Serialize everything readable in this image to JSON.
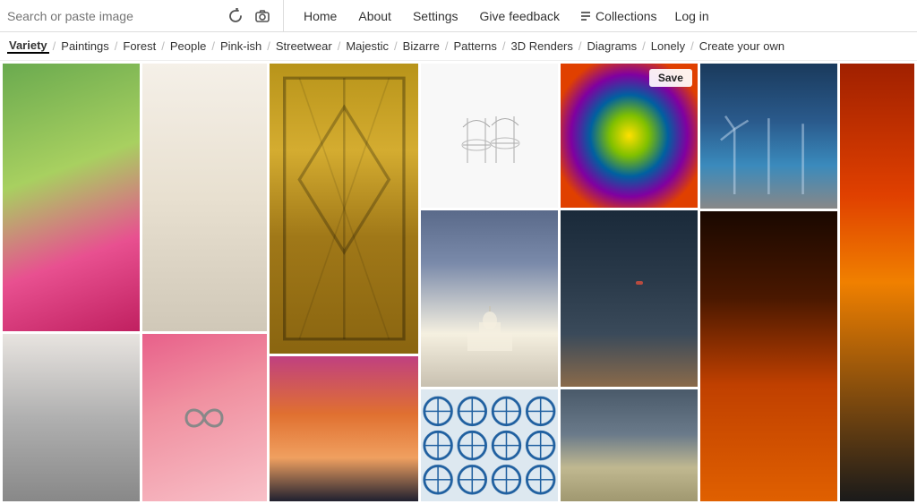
{
  "header": {
    "search_placeholder": "Search or paste image",
    "nav": {
      "home": "Home",
      "about": "About",
      "settings": "Settings",
      "give_feedback": "Give feedback",
      "collections": "Collections",
      "login": "Log in"
    }
  },
  "categories": [
    {
      "label": "Variety",
      "active": true
    },
    {
      "label": "Paintings",
      "active": false
    },
    {
      "label": "Forest",
      "active": false
    },
    {
      "label": "People",
      "active": false
    },
    {
      "label": "Pink-ish",
      "active": false
    },
    {
      "label": "Streetwear",
      "active": false
    },
    {
      "label": "Majestic",
      "active": false
    },
    {
      "label": "Bizarre",
      "active": false
    },
    {
      "label": "Patterns",
      "active": false
    },
    {
      "label": "3D Renders",
      "active": false
    },
    {
      "label": "Diagrams",
      "active": false
    },
    {
      "label": "Lonely",
      "active": false
    },
    {
      "label": "Create your own",
      "active": false
    }
  ],
  "save_label": "Save",
  "grid": {
    "columns": 7
  }
}
